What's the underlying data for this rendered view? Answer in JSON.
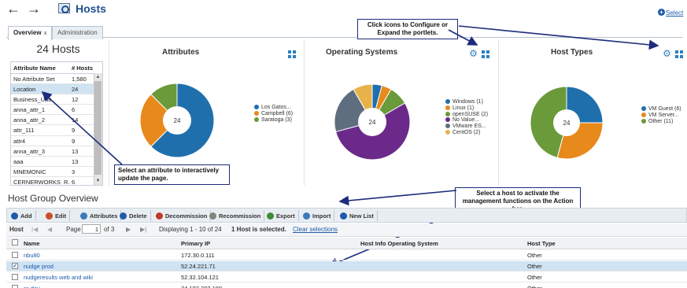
{
  "header": {
    "title": "Hosts",
    "select_link": "Select"
  },
  "tabs": [
    {
      "label": "Overview",
      "close": "x"
    },
    {
      "label": "Administration"
    }
  ],
  "left_panel": {
    "hosts_count": "24 Hosts",
    "columns": [
      "Attribute Name",
      "# Hosts"
    ],
    "rows": [
      {
        "name": "No Attribute Set",
        "count": "1,580"
      },
      {
        "name": "Location",
        "count": "24"
      },
      {
        "name": "Business_Unit",
        "count": "12"
      },
      {
        "name": "anna_attr_1",
        "count": "6"
      },
      {
        "name": "anna_attr_2",
        "count": "14"
      },
      {
        "name": "attr_111",
        "count": "9"
      },
      {
        "name": "attr4",
        "count": "9"
      },
      {
        "name": "anna_attr_3",
        "count": "13"
      },
      {
        "name": "aaa",
        "count": "13"
      },
      {
        "name": "MNEMONIC",
        "count": "3"
      },
      {
        "name": "CERNERWORKS_R...",
        "count": "6"
      }
    ]
  },
  "portlets": {
    "attributes": {
      "title": "Attributes",
      "center": "24",
      "slices": [
        {
          "label": "Los Gatos...",
          "value": 15,
          "color": "#1f6fad"
        },
        {
          "label": "Campbell (6)",
          "value": 6,
          "color": "#e8891c"
        },
        {
          "label": "Saratoga (3)",
          "value": 3,
          "color": "#6a9a3a"
        }
      ]
    },
    "operating_systems": {
      "title": "Operating Systems",
      "center": "24",
      "slices": [
        {
          "label": "Windows (1)",
          "value": 1,
          "color": "#1f6fad"
        },
        {
          "label": "Linux (1)",
          "value": 1,
          "color": "#e8891c"
        },
        {
          "label": "openSUSE (2)",
          "value": 2,
          "color": "#6a9a3a"
        },
        {
          "label": "No Value...",
          "value": 13,
          "color": "#6b2a8a"
        },
        {
          "label": "VMware ES...",
          "value": 5,
          "color": "#5e6e7e"
        },
        {
          "label": "CentOS (2)",
          "value": 2,
          "color": "#e8b24a"
        }
      ]
    },
    "host_types": {
      "title": "Host Types",
      "center": "24",
      "slices": [
        {
          "label": "VM Guest (6)",
          "value": 6,
          "color": "#1f6fad"
        },
        {
          "label": "VM Server...",
          "value": 7,
          "color": "#e8891c"
        },
        {
          "label": "Other (11)",
          "value": 11,
          "color": "#6a9a3a"
        }
      ]
    }
  },
  "callouts": {
    "configure": "Click icons to Configure or Expand the portlets.",
    "attribute": "Select an attribute to interactively update the page.",
    "host": "Select a host to activate the management functions on the Action bar."
  },
  "host_group": {
    "title": "Host Group Overview",
    "toolbar": [
      {
        "label": "Add",
        "icon": "add-icon",
        "color": "#1f5aa8"
      },
      {
        "label": "Edit",
        "icon": "edit-icon",
        "color": "#c9502a"
      },
      {
        "label": "Attributes",
        "icon": "attributes-icon",
        "color": "#3a7ab8"
      },
      {
        "label": "Delete",
        "icon": "delete-icon",
        "color": "#1f5aa8"
      },
      {
        "label": "Decommission",
        "icon": "decommission-icon",
        "color": "#c0392b"
      },
      {
        "label": "Recommission",
        "icon": "recommission-icon",
        "color": "#7a8a7a"
      },
      {
        "label": "Export",
        "icon": "export-icon",
        "color": "#3f8a3a"
      },
      {
        "label": "Import",
        "icon": "import-icon",
        "color": "#3a7ab8"
      },
      {
        "label": "New List",
        "icon": "new-list-icon",
        "color": "#1f5aa8"
      }
    ],
    "pager": {
      "entity": "Host",
      "page_label": "Page",
      "page_value": "1",
      "of_label": "of 3",
      "displaying": "Displaying 1 - 10 of 24",
      "selection": "1 Host is selected.",
      "clear": "Clear selections"
    },
    "columns": [
      "Name",
      "Primary IP",
      "Host Info Operating System",
      "Host Type"
    ],
    "rows": [
      {
        "name": "nbu80",
        "ip": "172.30.0.111",
        "os": "",
        "type": "Other",
        "selected": false
      },
      {
        "name": "nudge prod",
        "ip": "52.24.221.71",
        "os": "",
        "type": "Other",
        "selected": true
      },
      {
        "name": "nudgeresults web and wiki",
        "ip": "52.32.104.121",
        "os": "",
        "type": "Other",
        "selected": false
      },
      {
        "name": "sr-dev",
        "ip": "34.192.202.190",
        "os": "",
        "type": "Other",
        "selected": false
      }
    ]
  }
}
